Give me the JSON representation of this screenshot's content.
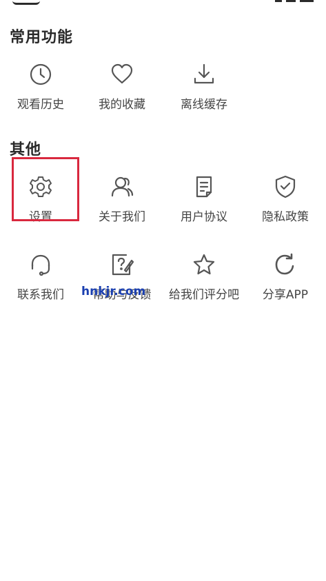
{
  "sections": {
    "common": {
      "title": "常用功能",
      "items": [
        {
          "label": "观看历史",
          "icon": "clock-icon"
        },
        {
          "label": "我的收藏",
          "icon": "heart-icon"
        },
        {
          "label": "离线缓存",
          "icon": "download-icon"
        }
      ]
    },
    "other": {
      "title": "其他",
      "items": [
        {
          "label": "设置",
          "icon": "gear-icon"
        },
        {
          "label": "关于我们",
          "icon": "users-icon"
        },
        {
          "label": "用户协议",
          "icon": "document-icon"
        },
        {
          "label": "隐私政策",
          "icon": "shield-check-icon"
        },
        {
          "label": "联系我们",
          "icon": "headset-icon"
        },
        {
          "label": "帮助与反馈",
          "icon": "help-edit-icon"
        },
        {
          "label": "给我们评分吧",
          "icon": "star-icon"
        },
        {
          "label": "分享APP",
          "icon": "share-refresh-icon"
        }
      ]
    }
  },
  "watermark": "hnkjr.com",
  "colors": {
    "highlight": "#d9283e",
    "icon": "#555555",
    "watermark": "#1a3fb0"
  }
}
